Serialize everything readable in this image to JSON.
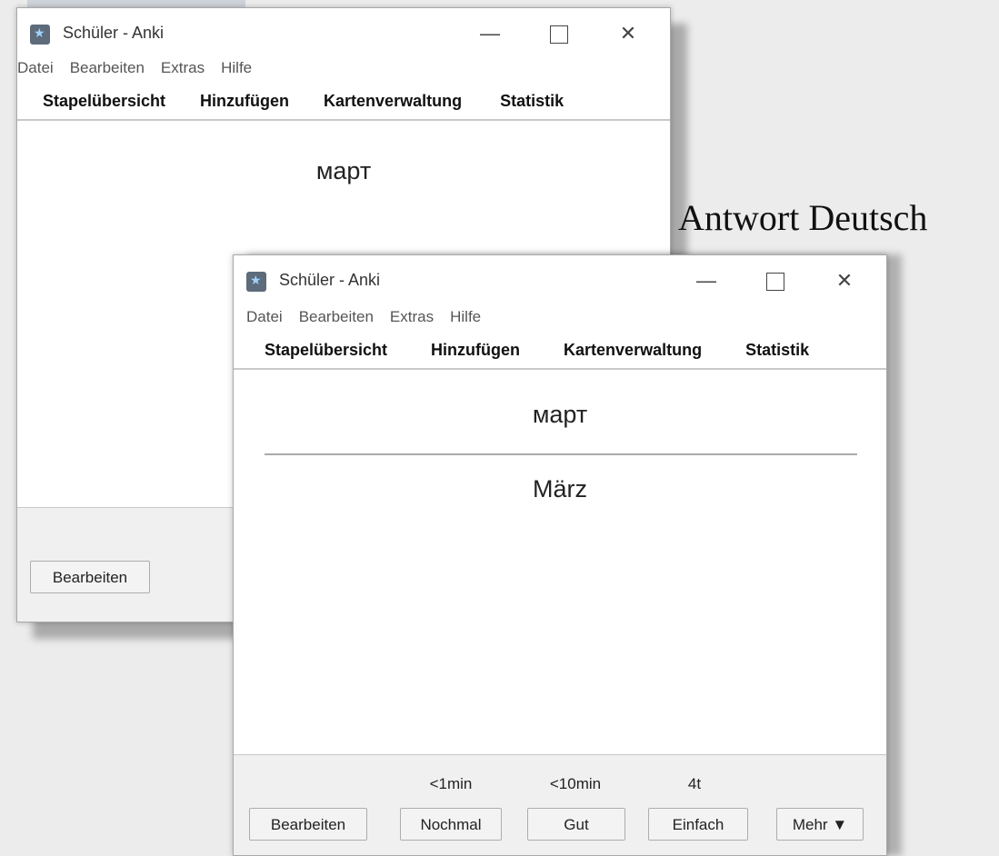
{
  "caption": "Antwort Deutsch",
  "window_back": {
    "title": "Schüler - Anki",
    "menu": [
      "Datei",
      "Bearbeiten",
      "Extras",
      "Hilfe"
    ],
    "toolbar": [
      "Stapelübersicht",
      "Hinzufügen",
      "Kartenverwaltung",
      "Statistik"
    ],
    "question": "март",
    "edit_button": "Bearbeiten"
  },
  "window_front": {
    "title": "Schüler - Anki",
    "menu": [
      "Datei",
      "Bearbeiten",
      "Extras",
      "Hilfe"
    ],
    "toolbar": [
      "Stapelübersicht",
      "Hinzufügen",
      "Kartenverwaltung",
      "Statistik"
    ],
    "question": "март",
    "answer": "März",
    "intervals": {
      "again": "<1min",
      "good": "<10min",
      "easy": "4t"
    },
    "buttons": {
      "edit": "Bearbeiten",
      "again": "Nochmal",
      "good": "Gut",
      "easy": "Einfach",
      "more": "Mehr ▼"
    }
  },
  "icons": {
    "window_controls": [
      "minimize-icon",
      "maximize-icon",
      "close-icon"
    ],
    "app": "anki-icon"
  }
}
